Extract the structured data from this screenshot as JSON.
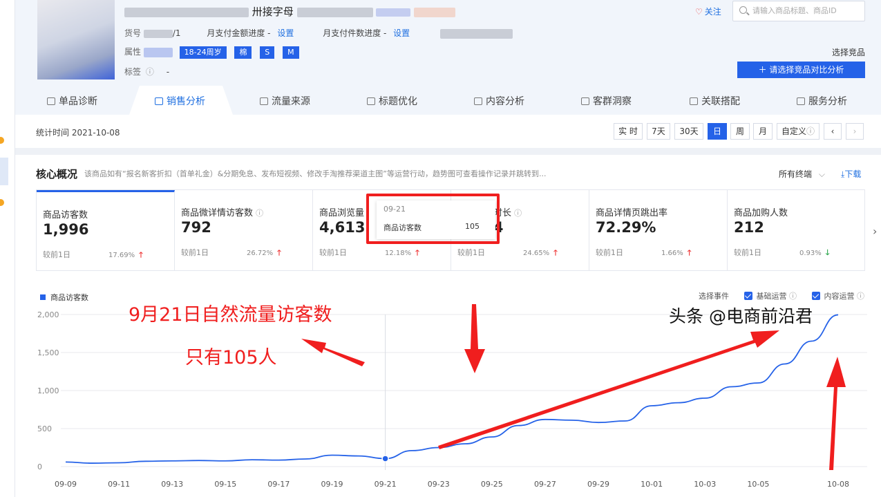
{
  "product": {
    "title_suffix": "卅接字母",
    "sku_label": "货号",
    "sku_value_tail": "/1",
    "monthly_amount_progress": "月支付金额进度 -",
    "monthly_count_progress": "月支付件数进度 -",
    "set_link": "设置",
    "attr_label": "属性",
    "attrs": [
      "18-24周岁",
      "棉",
      "S",
      "M"
    ],
    "tag_label": "标签",
    "tag_value": "-"
  },
  "header": {
    "follow_label": "关注",
    "search_placeholder": "请输入商品标题、商品ID",
    "choose_competitor": "选择竞品",
    "compare_button": "请选择竞品对比分析"
  },
  "tabs": [
    {
      "label": "单品诊断",
      "active": false
    },
    {
      "label": "销售分析",
      "active": true
    },
    {
      "label": "流量来源",
      "active": false
    },
    {
      "label": "标题优化",
      "active": false
    },
    {
      "label": "内容分析",
      "active": false
    },
    {
      "label": "客群洞察",
      "active": false
    },
    {
      "label": "关联搭配",
      "active": false
    },
    {
      "label": "服务分析",
      "active": false
    }
  ],
  "filter": {
    "stat_time": "统计时间 2021-10-08",
    "periods": [
      {
        "label": "实 时",
        "active": false
      },
      {
        "label": "7天",
        "active": false
      },
      {
        "label": "30天",
        "active": false
      },
      {
        "label": "日",
        "active": true
      },
      {
        "label": "周",
        "active": false
      },
      {
        "label": "月",
        "active": false
      },
      {
        "label": "自定义",
        "active": false
      },
      {
        "label": "‹",
        "active": false
      },
      {
        "label": "›",
        "active": false
      }
    ]
  },
  "core": {
    "title": "核心概况",
    "description": "该商品如有“报名新客折扣（首单礼金）&分期免息、发布短视频、修改手淘推荐渠道主图”等运营行动，趋势图可查看操作记录并跳转到...",
    "terminal": "所有终端",
    "download": "下载",
    "compare_label": "较前1日",
    "metrics": [
      {
        "name": "商品访客数",
        "value": "1,996",
        "pct": "17.69%",
        "trend": "up",
        "help": false
      },
      {
        "name": "商品微详情访客数",
        "value": "792",
        "pct": "26.72%",
        "trend": "up",
        "help": true
      },
      {
        "name": "商品浏览量",
        "value": "4,613",
        "pct": "12.18%",
        "trend": "up",
        "help": false
      },
      {
        "name": "平均停留时长",
        "value": "13.74",
        "pct": "24.65%",
        "trend": "up",
        "help": true
      },
      {
        "name": "商品详情页跳出率",
        "value": "72.29%",
        "pct": "1.66%",
        "trend": "up",
        "help": false
      },
      {
        "name": "商品加购人数",
        "value": "212",
        "pct": "0.93%",
        "trend": "down",
        "help": false
      }
    ]
  },
  "chart_controls": {
    "select_event": "选择事件",
    "basic_ops": "基础运营",
    "content_ops": "内容运营"
  },
  "chart_data": {
    "type": "line",
    "series": [
      {
        "name": "商品访客数",
        "values": [
          60,
          45,
          50,
          70,
          75,
          80,
          75,
          90,
          85,
          100,
          150,
          140,
          105,
          210,
          250,
          300,
          390,
          540,
          620,
          610,
          580,
          600,
          800,
          840,
          900,
          1050,
          1100,
          1350,
          1650,
          1996
        ]
      }
    ],
    "x": [
      "09-09",
      "09-10",
      "09-11",
      "09-12",
      "09-13",
      "09-14",
      "09-15",
      "09-16",
      "09-17",
      "09-18",
      "09-19",
      "09-20",
      "09-21",
      "09-22",
      "09-23",
      "09-24",
      "09-25",
      "09-26",
      "09-27",
      "09-28",
      "09-29",
      "09-30",
      "10-01",
      "10-02",
      "10-03",
      "10-04",
      "10-05",
      "10-06",
      "10-07",
      "10-08"
    ],
    "x_tick_labels": [
      "09-09",
      "09-11",
      "09-13",
      "09-15",
      "09-17",
      "09-19",
      "09-21",
      "09-23",
      "09-25",
      "09-27",
      "09-29",
      "10-01",
      "10-03",
      "10-05",
      "10-08"
    ],
    "y_ticks": [
      0,
      500,
      1000,
      1500,
      2000
    ],
    "y_tick_labels": [
      "0",
      "500",
      "1,000",
      "1,500",
      "2,000"
    ],
    "ylim": [
      0,
      2000
    ],
    "grid": true,
    "legend": "top-left",
    "highlight_index": 12,
    "color": "#2562e8"
  },
  "tooltip": {
    "date": "09-21",
    "name": "商品访客数",
    "value": "105"
  },
  "annotations": {
    "line1": "9月21日自然流量访客数",
    "line2": "只有105人"
  },
  "watermark": "头条 @电商前沿君"
}
